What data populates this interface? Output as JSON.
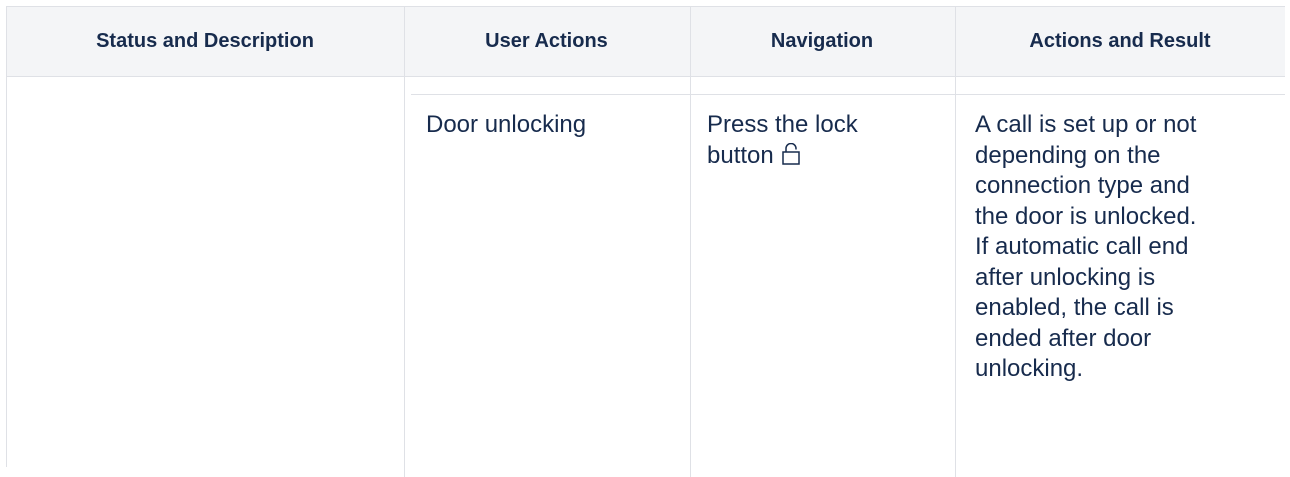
{
  "table": {
    "headers": {
      "status": "Status and Description",
      "user_actions": "User Actions",
      "navigation": "Navigation",
      "actions_result": "Actions and Result"
    },
    "row": {
      "status": "",
      "user_action": "Door unlocking",
      "navigation_lines": [
        "Press the lock",
        "button"
      ],
      "navigation_icon": "lock-open-icon",
      "result_lines": [
        "A call is set up or not",
        "depending on the",
        "connection type and",
        "the door is unlocked.",
        "If automatic call end",
        "after unlocking is",
        "enabled, the call is",
        "ended after door",
        "unlocking."
      ]
    }
  },
  "colors": {
    "header_bg": "#f4f5f7",
    "border": "#dfe1e6",
    "text": "#172b4d"
  }
}
